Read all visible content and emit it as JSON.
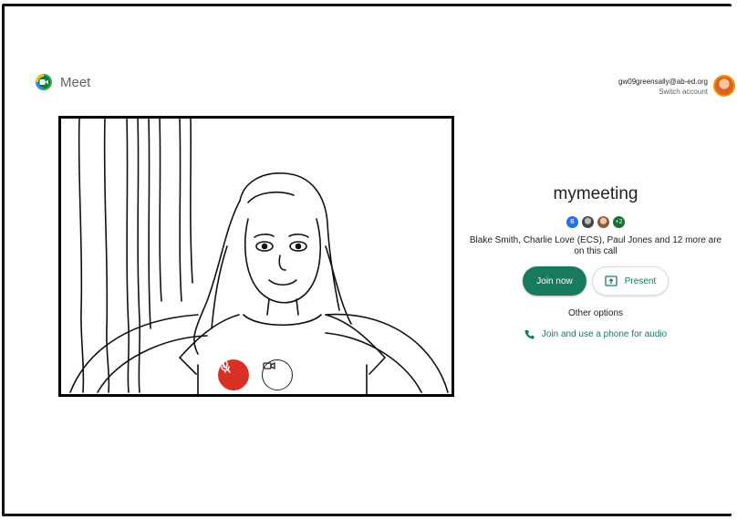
{
  "header": {
    "product_name": "Meet",
    "account_email": "gw09greensally@ab-ed.org",
    "switch_account": "Switch account"
  },
  "preview": {
    "mic_state": "muted",
    "camera_state": "on"
  },
  "join_panel": {
    "meeting_title": "mymeeting",
    "participant_initial": "B",
    "more_count": "+2",
    "participants_line1": "Blake Smith, Charlie Love (ECS), Paul Jones and 12 more are",
    "participants_line2": "on this call",
    "join_now_label": "Join now",
    "present_label": "Present",
    "other_options_label": "Other options",
    "phone_audio_label": "Join and use a phone for audio"
  },
  "colors": {
    "accent": "#1a7a5e",
    "mic_muted": "#d93025",
    "avatar_blue": "#1a73e8",
    "avatar_green": "#137333"
  }
}
